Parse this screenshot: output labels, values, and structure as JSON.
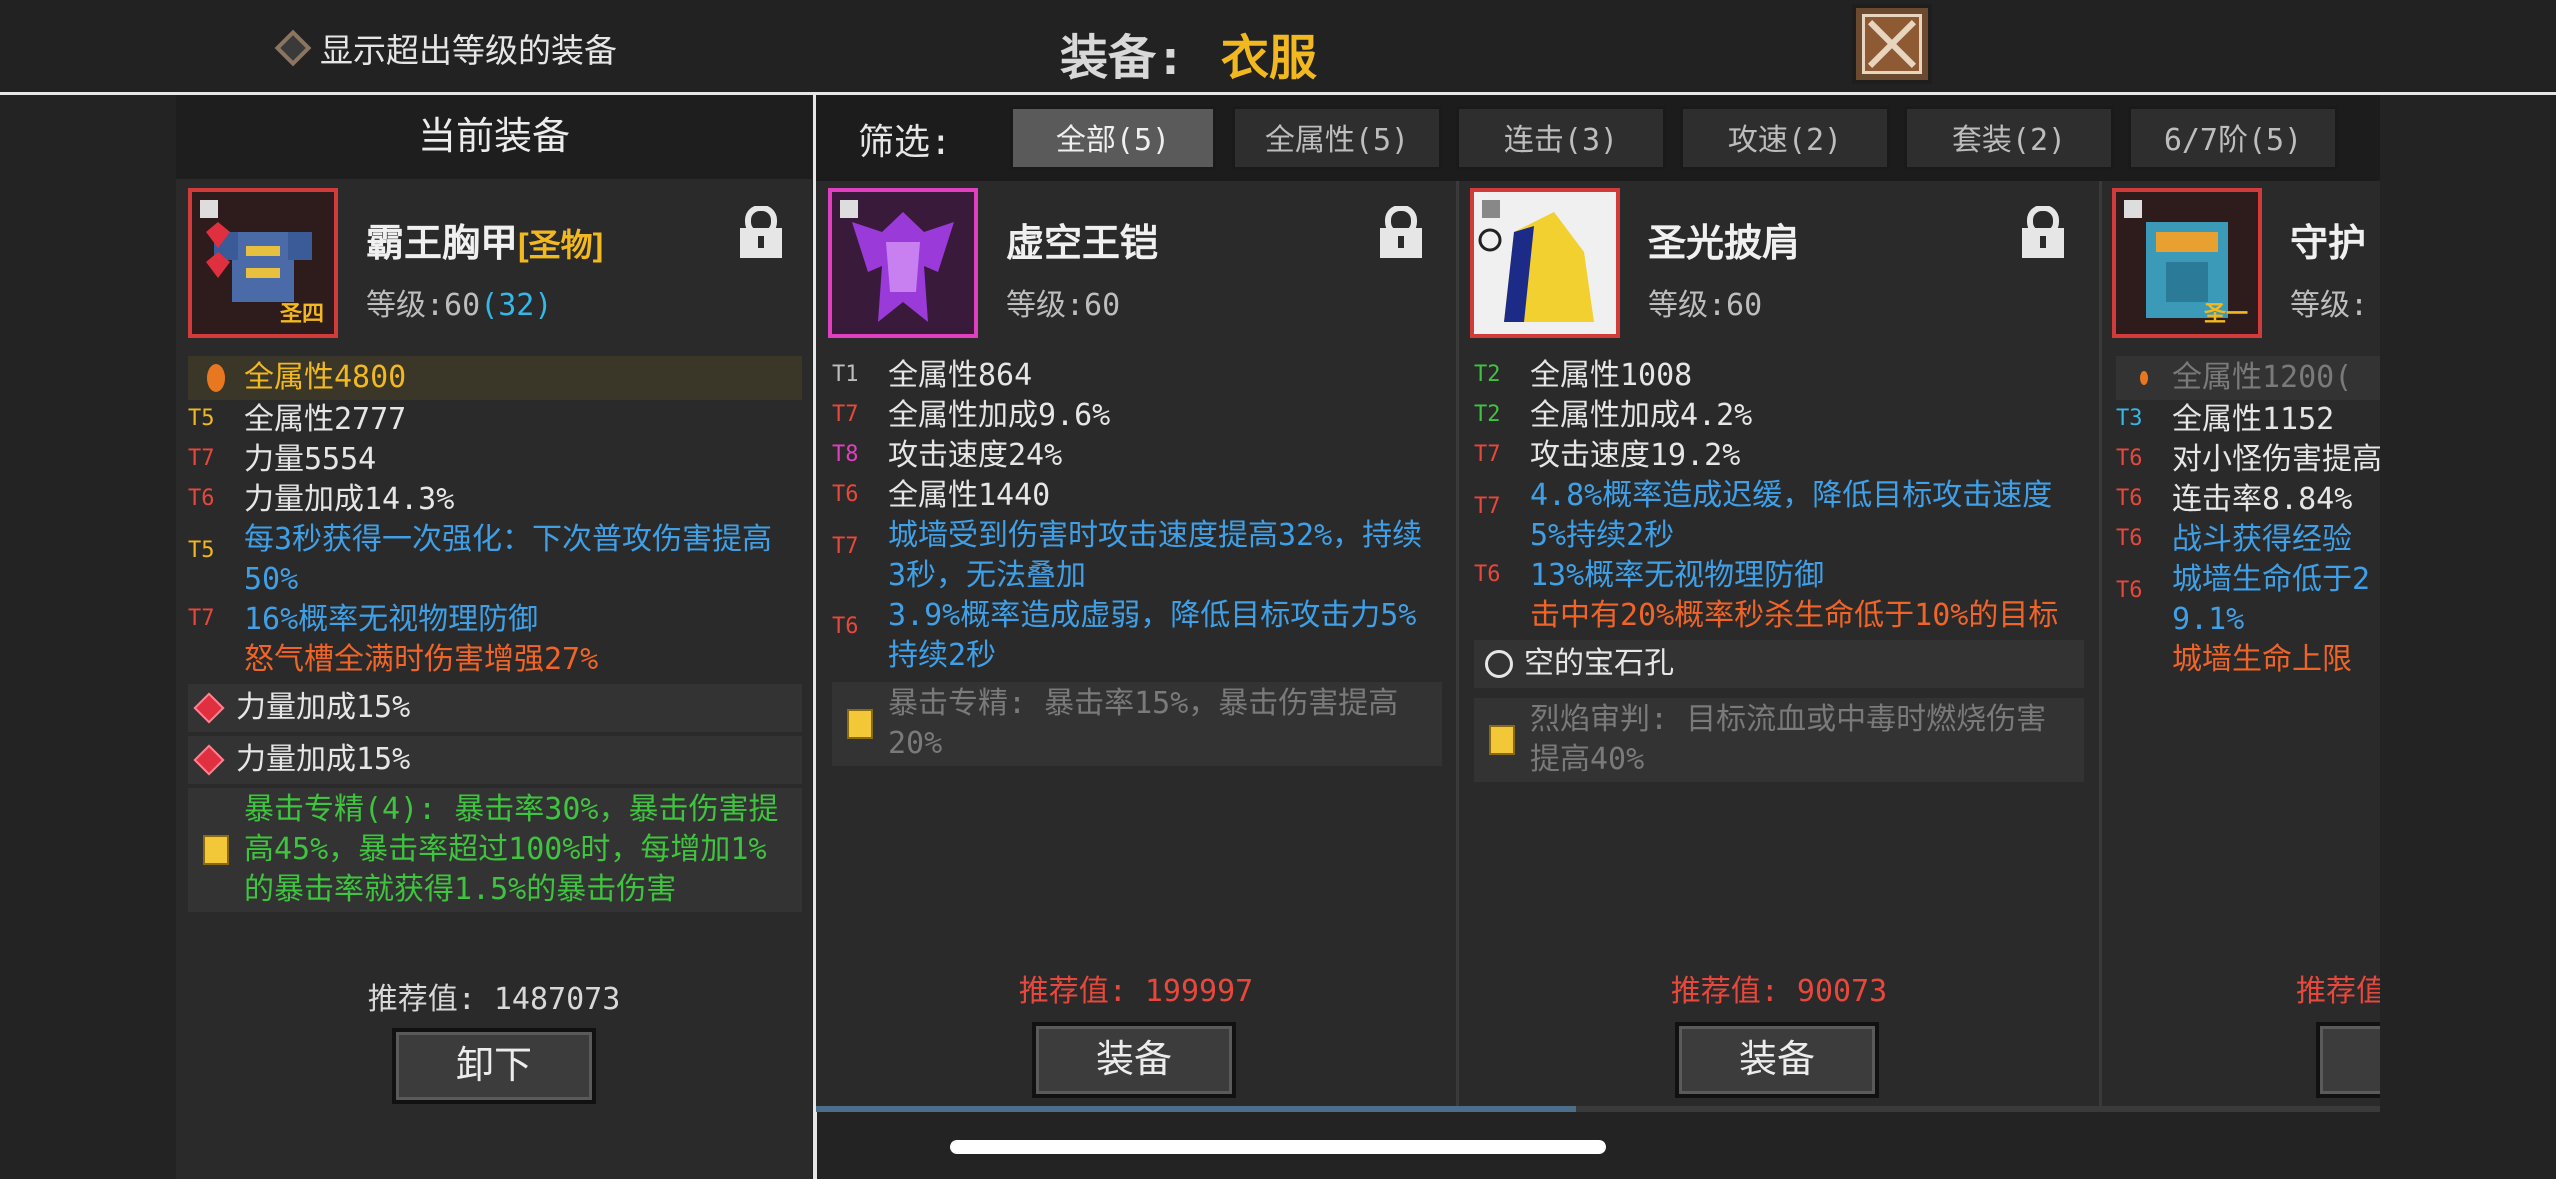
{
  "header": {
    "toggle_label": "显示超出等级的装备",
    "title_label": "装备:",
    "title_value": "衣服"
  },
  "left_panel": {
    "heading": "当前装备",
    "item": {
      "name": "霸王胸甲",
      "tag": "[圣物]",
      "level_label": "等级:60",
      "level_extra": "(32)",
      "badge": "圣四",
      "stats": [
        {
          "tier": "",
          "text": "全属性4800"
        },
        {
          "tier": "T5",
          "text": "全属性2777"
        },
        {
          "tier": "T7",
          "text": "力量5554"
        },
        {
          "tier": "T6",
          "text": "力量加成14.3%"
        },
        {
          "tier": "T5",
          "text": "每3秒获得一次强化：下次普攻伤害提高50%"
        },
        {
          "tier": "T7",
          "text": "16%概率无视物理防御"
        },
        {
          "tier": "",
          "text": "怒气槽全满时伤害增强27%"
        }
      ],
      "gems": [
        "力量加成15%",
        "力量加成15%"
      ],
      "set_bonus": "暴击专精(4): 暴击率30%，暴击伤害提高45%，暴击率超过100%时，每增加1%的暴击率就获得1.5%的暴击伤害"
    },
    "recommend": "推荐值: 1487073",
    "unequip_button": "卸下"
  },
  "filter": {
    "label": "筛选:",
    "tabs": [
      "全部(5)",
      "全属性(5)",
      "连击(3)",
      "攻速(2)",
      "套装(2)",
      "6/7阶(5)"
    ]
  },
  "items": [
    {
      "name": "虚空王铠",
      "level_label": "等级:60",
      "stats": [
        {
          "tier": "T1",
          "text": "全属性864"
        },
        {
          "tier": "T7",
          "text": "全属性加成9.6%"
        },
        {
          "tier": "T8",
          "text": "攻击速度24%"
        },
        {
          "tier": "T6",
          "text": "全属性1440"
        },
        {
          "tier": "T7",
          "text": "城墙受到伤害时攻击速度提高32%，持续3秒，无法叠加"
        },
        {
          "tier": "T6",
          "text": "3.9%概率造成虚弱，降低目标攻击力5%持续2秒"
        }
      ],
      "set_bonus": "暴击专精: 暴击率15%，暴击伤害提高20%",
      "recommend": "推荐值: 199997",
      "button": "装备"
    },
    {
      "name": "圣光披肩",
      "level_label": "等级:60",
      "stats": [
        {
          "tier": "T2",
          "text": "全属性1008"
        },
        {
          "tier": "T2",
          "text": "全属性加成4.2%"
        },
        {
          "tier": "T7",
          "text": "攻击速度19.2%"
        },
        {
          "tier": "T7",
          "text": "4.8%概率造成迟缓，降低目标攻击速度5%持续2秒"
        },
        {
          "tier": "T6",
          "text": "13%概率无视物理防御"
        },
        {
          "tier": "",
          "text": "击中有20%概率秒杀生命低于10%的目标"
        }
      ],
      "socket": "空的宝石孔",
      "set_bonus": "烈焰审判: 目标流血或中毒时燃烧伤害提高40%",
      "recommend": "推荐值: 90073",
      "button": "装备"
    },
    {
      "name": "守护",
      "level_label": "等级:",
      "badge": "圣一",
      "stats": [
        {
          "tier": "",
          "text": "全属性1200("
        },
        {
          "tier": "T3",
          "text": "全属性1152"
        },
        {
          "tier": "T6",
          "text": "对小怪伤害提高"
        },
        {
          "tier": "T6",
          "text": "连击率8.84%"
        },
        {
          "tier": "T6",
          "text": "战斗获得经验"
        },
        {
          "tier": "T6",
          "text": "城墙生命低于2 9.1%"
        },
        {
          "tier": "",
          "text": "城墙生命上限"
        }
      ],
      "recommend": "推荐值"
    }
  ]
}
